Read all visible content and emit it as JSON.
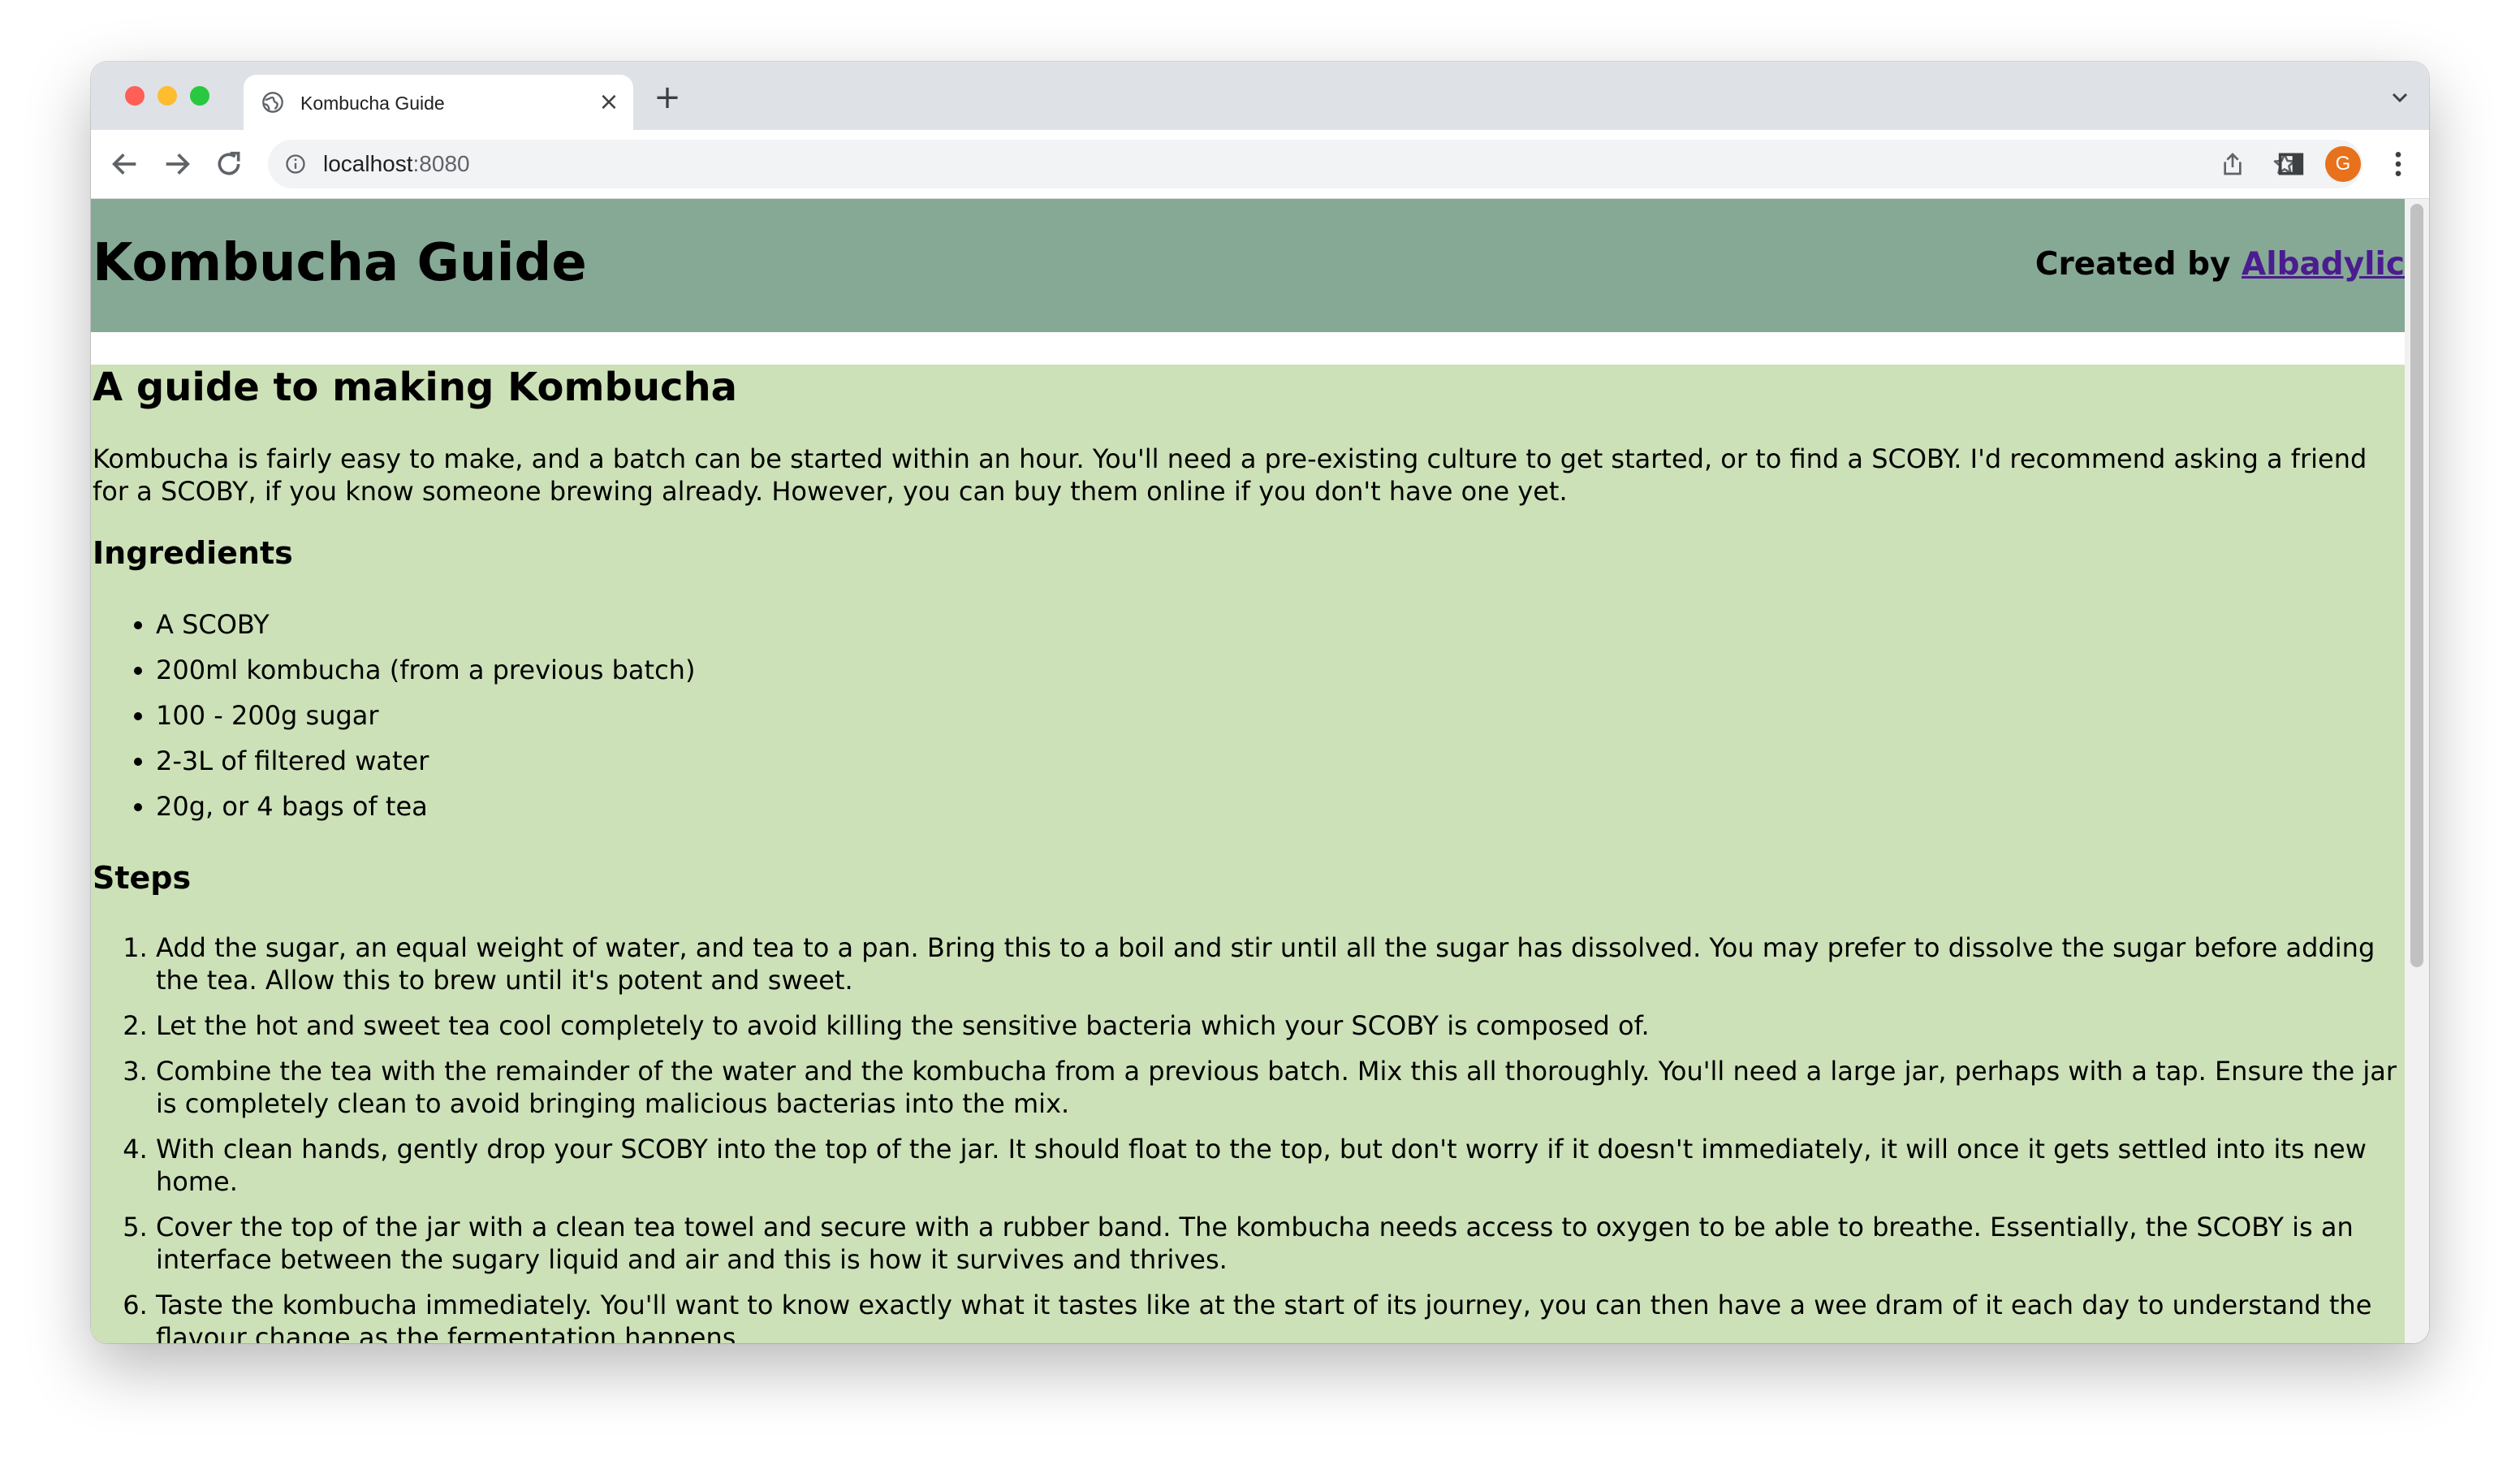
{
  "browser": {
    "tab_title": "Kombucha Guide",
    "url_host": "localhost",
    "url_port": ":8080",
    "avatar_initial": "G"
  },
  "header": {
    "title": "Kombucha Guide",
    "created_by_label": "Created by",
    "author_link": "Albadylic"
  },
  "main": {
    "heading": "A guide to making Kombucha",
    "intro": "Kombucha is fairly easy to make, and a batch can be started within an hour. You'll need a pre-existing culture to get started, or to find a SCOBY. I'd recommend asking a friend for a SCOBY, if you know someone brewing already. However, you can buy them online if you don't have one yet.",
    "ingredients_heading": "Ingredients",
    "ingredients": [
      "A SCOBY",
      "200ml kombucha (from a previous batch)",
      "100 - 200g sugar",
      "2-3L of filtered water",
      "20g, or 4 bags of tea"
    ],
    "steps_heading": "Steps",
    "steps": [
      "Add the sugar, an equal weight of water, and tea to a pan. Bring this to a boil and stir until all the sugar has dissolved. You may prefer to dissolve the sugar before adding the tea. Allow this to brew until it's potent and sweet.",
      "Let the hot and sweet tea cool completely to avoid killing the sensitive bacteria which your SCOBY is composed of.",
      "Combine the tea with the remainder of the water and the kombucha from a previous batch. Mix this all thoroughly. You'll need a large jar, perhaps with a tap. Ensure the jar is completely clean to avoid bringing malicious bacterias into the mix.",
      "With clean hands, gently drop your SCOBY into the top of the jar. It should float to the top, but don't worry if it doesn't immediately, it will once it gets settled into its new home.",
      "Cover the top of the jar with a clean tea towel and secure with a rubber band. The kombucha needs access to oxygen to be able to breathe. Essentially, the SCOBY is an interface between the sugary liquid and air and this is how it survives and thrives.",
      "Taste the kombucha immediately. You'll want to know exactly what it tastes like at the start of its journey, you can then have a wee dram of it each day to understand the flavour change as the fermentation happens."
    ]
  },
  "colors": {
    "header_bg": "#86a995",
    "content_bg": "#cde1b8",
    "link": "#4b1c8f"
  }
}
